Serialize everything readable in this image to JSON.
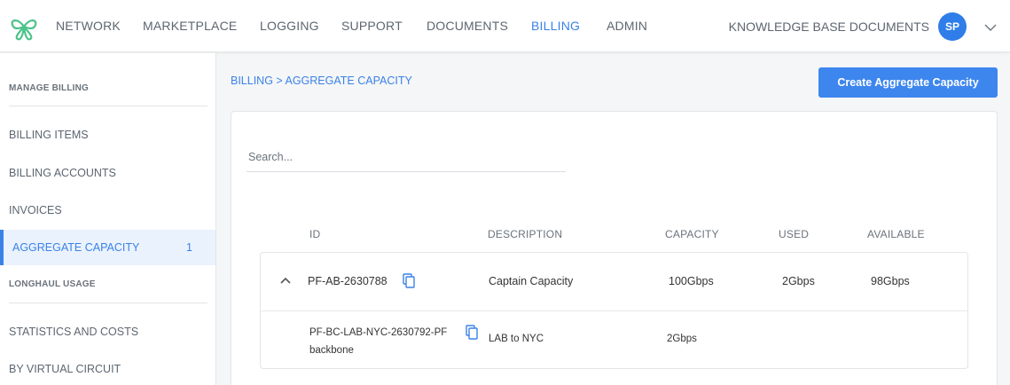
{
  "nav": {
    "items": [
      {
        "label": "NETWORK",
        "active": false
      },
      {
        "label": "MARKETPLACE",
        "active": false
      },
      {
        "label": "LOGGING",
        "active": false
      },
      {
        "label": "SUPPORT",
        "active": false
      },
      {
        "label": "DOCUMENTS",
        "active": false
      },
      {
        "label": "BILLING",
        "active": true
      },
      {
        "label": "ADMIN",
        "active": false
      }
    ],
    "kb_label": "KNOWLEDGE BASE DOCUMENTS",
    "avatar_initials": "SP"
  },
  "sidebar": {
    "section1": "MANAGE BILLING",
    "items1": [
      {
        "label": "BILLING ITEMS"
      },
      {
        "label": "BILLING ACCOUNTS"
      },
      {
        "label": "INVOICES"
      },
      {
        "label": "AGGREGATE CAPACITY",
        "count": "1",
        "active": true
      }
    ],
    "section2": "LONGHAUL USAGE",
    "items2": [
      {
        "label": "STATISTICS AND COSTS"
      },
      {
        "label": "BY VIRTUAL CIRCUIT"
      }
    ]
  },
  "main": {
    "breadcrumb": "BILLING > AGGREGATE CAPACITY",
    "create_button": "Create Aggregate Capacity",
    "search_placeholder": "Search...",
    "columns": [
      "ID",
      "DESCRIPTION",
      "CAPACITY",
      "USED",
      "AVAILABLE"
    ],
    "parent_row": {
      "id": "PF-AB-2630788",
      "description": "Captain Capacity",
      "capacity": "100Gbps",
      "used": "2Gbps",
      "available": "98Gbps"
    },
    "child_row": {
      "id": "PF-BC-LAB-NYC-2630792-PF",
      "sub": "backbone",
      "description": "LAB to NYC",
      "capacity": "2Gbps"
    }
  },
  "colors": {
    "accent": "#3b82e8",
    "button": "#3d86ee",
    "logo": "#4cc38a"
  }
}
